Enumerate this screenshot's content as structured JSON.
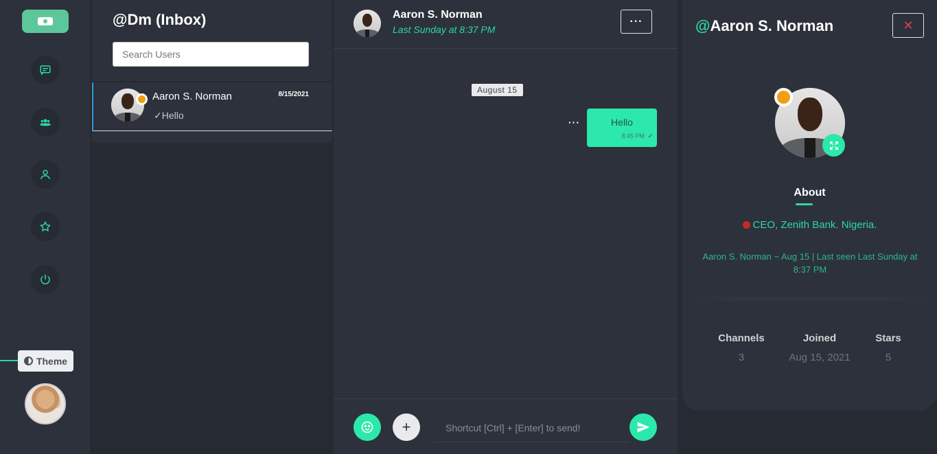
{
  "theme": {
    "accent": "#2bd9a0",
    "panel": "#2d313b",
    "background": "#262a33",
    "status_away": "#f29d12"
  },
  "rail": {
    "nav": [
      {
        "name": "chat",
        "icon": "message-icon"
      },
      {
        "name": "groups",
        "icon": "users-icon"
      },
      {
        "name": "profile",
        "icon": "user-icon"
      },
      {
        "name": "starred",
        "icon": "star-icon"
      },
      {
        "name": "logout",
        "icon": "power-icon"
      }
    ],
    "theme_label": "Theme"
  },
  "inbox": {
    "title": "@Dm (Inbox)",
    "search_placeholder": "Search Users",
    "conversations": [
      {
        "name": "Aaron S. Norman",
        "date": "8/15/2021",
        "preview": "Hello",
        "preview_status": "✓"
      }
    ]
  },
  "chat": {
    "contact_name": "Aaron S. Norman",
    "last_seen": "Last Sunday at 8:37 PM",
    "menu_label": "···",
    "date_divider": "August 15",
    "messages": [
      {
        "text": "Hello",
        "time": "8:45 PM",
        "status": "✓",
        "outgoing": true
      }
    ],
    "message_menu": "···",
    "input_placeholder": "Shortcut [Ctrl] + [Enter] to send!",
    "plus_label": "+"
  },
  "profile": {
    "at": "@",
    "name": "Aaron S. Norman",
    "close_label": "✕",
    "about_label": "About",
    "bio": "CEO, Zenith Bank. Nigeria.",
    "seen_text": "Aaron S. Norman ~ Aug 15 | Last seen Last Sunday at 8:37 PM",
    "stats": [
      {
        "label": "Channels",
        "value": "3"
      },
      {
        "label": "Joined",
        "value": "Aug 15, 2021"
      },
      {
        "label": "Stars",
        "value": "5"
      }
    ]
  }
}
